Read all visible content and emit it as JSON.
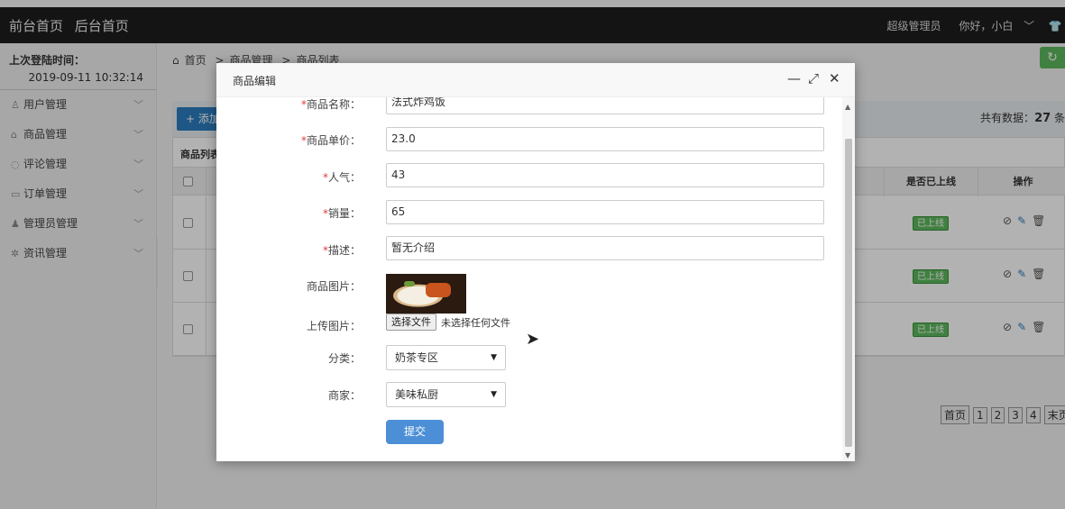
{
  "topbar": {
    "nav": [
      "前台首页",
      "后台首页"
    ],
    "role": "超级管理员",
    "greeting": "你好，小白",
    "chevron": "﹀",
    "shirt_icon": "tshirt-icon"
  },
  "sidebar": {
    "login_title": "上次登陆时间：",
    "login_time": "2019-09-11 10:32:14",
    "items": [
      {
        "label": "用户管理",
        "icon": "user-icon"
      },
      {
        "label": "商品管理",
        "icon": "bag-icon"
      },
      {
        "label": "评论管理",
        "icon": "comment-icon"
      },
      {
        "label": "订单管理",
        "icon": "order-icon"
      },
      {
        "label": "管理员管理",
        "icon": "admin-icon"
      },
      {
        "label": "资讯管理",
        "icon": "gear-icon"
      }
    ]
  },
  "main": {
    "breadcrumb": [
      "首页",
      "商品管理",
      "商品列表"
    ],
    "add_label": "添加",
    "total_label": "共有数据：",
    "total_value": "27",
    "total_suffix": "条",
    "table_caption": "商品列表",
    "col_online": "是否已上线",
    "col_ops": "操作",
    "rows": [
      {
        "status": "已上线"
      },
      {
        "status": "已上线"
      },
      {
        "status": "已上线"
      }
    ],
    "pagination": [
      "首页",
      "1",
      "2",
      "3",
      "4",
      "末页"
    ]
  },
  "modal": {
    "title": "商品编辑",
    "fields": {
      "name_label": "商品名称：",
      "name_value": "法式炸鸡饭",
      "price_label": "商品单价：",
      "price_value": "23.0",
      "popularity_label": "人气：",
      "popularity_value": "43",
      "sales_label": "销量：",
      "sales_value": "65",
      "desc_label": "描述：",
      "desc_value": "暂无介绍",
      "image_label": "商品图片：",
      "upload_label": "上传图片：",
      "file_button": "选择文件",
      "file_none": "未选择任何文件",
      "category_label": "分类：",
      "category_value": "奶茶专区",
      "merchant_label": "商家：",
      "merchant_value": "美味私厨",
      "required_mark": "*"
    },
    "submit_label": "提交"
  },
  "colors": {
    "accent": "#4d8fd6",
    "online_green": "#5cb85c",
    "required_red": "#e4393c",
    "topbar": "#1e1e1e"
  }
}
